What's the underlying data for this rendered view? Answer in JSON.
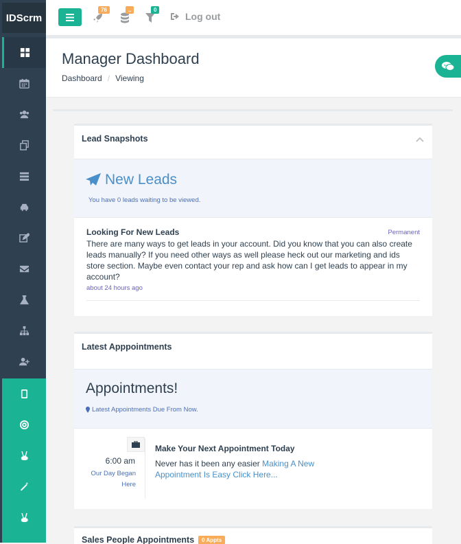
{
  "brand": "IDScrm",
  "topbar": {
    "notifications": [
      {
        "icon": "rocket-icon",
        "count": "76",
        "color": "#f8ac59"
      },
      {
        "icon": "database-icon",
        "count": "..",
        "color": "#f8ac59"
      },
      {
        "icon": "filter-icon",
        "count": "0",
        "color": "#1ab394"
      }
    ],
    "logout_label": "Log out"
  },
  "sidebar": {
    "items": [
      {
        "icon": "dashboard-icon"
      },
      {
        "icon": "calendar-icon"
      },
      {
        "icon": "users-icon"
      },
      {
        "icon": "files-icon"
      },
      {
        "icon": "list-icon"
      },
      {
        "icon": "car-icon"
      },
      {
        "icon": "edit-icon"
      },
      {
        "icon": "envelope-icon"
      },
      {
        "icon": "flask-icon"
      },
      {
        "icon": "sitemap-icon"
      },
      {
        "icon": "user-plus-icon"
      },
      {
        "icon": "tablet-icon"
      },
      {
        "icon": "lifebuoy-icon"
      },
      {
        "icon": "victory-icon"
      },
      {
        "icon": "magic-wand-icon"
      },
      {
        "icon": "victory-icon"
      }
    ]
  },
  "heading": {
    "title": "Manager Dashboard",
    "breadcrumb": [
      "Dashboard",
      "Viewing"
    ]
  },
  "lead_snapshots": {
    "title": "Lead Snapshots",
    "new_leads_title": "New Leads",
    "new_leads_sub": "You have 0 leads waiting to be viewed.",
    "feed": {
      "title": "Looking For New Leads",
      "tag": "Permanent",
      "text": "There are many ways to get leads in your account. Did you know that you can also create leads manually? If you need other ways as well please heck out our marketing and ids store section. Maybe even contact your rep and ask how can I get leads to appear in my account?",
      "time": "about 24 hours ago"
    }
  },
  "appointments": {
    "title": "Latest Apppointments",
    "jumbo_title": "Appointments!",
    "jumbo_sub": "Latest Appointments Due From Now.",
    "item": {
      "time": "6:00 am",
      "when": "Our Day Began Here",
      "head": "Make Your Next Appointment Today",
      "text": "Never has it been any easier ",
      "link": "Making A New Appointment Is Easy Click Here..."
    }
  },
  "sales": {
    "title": "Sales People Appointments",
    "badge": "0 Appts"
  }
}
